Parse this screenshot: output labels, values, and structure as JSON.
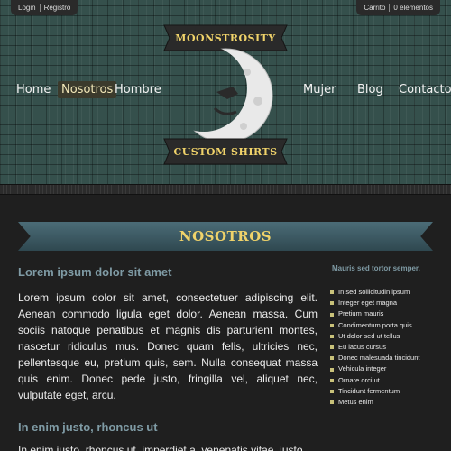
{
  "topbar": {
    "login": "Login",
    "register": "Registro",
    "cart": "Carrito",
    "cart_count": "0 elementos"
  },
  "nav": {
    "home": "Home",
    "about": "Nosotros",
    "men": "Hombre",
    "women": "Mujer",
    "blog": "Blog",
    "contact": "Contacto"
  },
  "logo": {
    "top_text": "MOONSTROSITY",
    "bottom_text": "CUSTOM SHIRTS"
  },
  "page": {
    "banner_title": "NOSOTROS",
    "heading1": "Lorem ipsum dolor sit amet",
    "paragraph1": "Lorem ipsum dolor sit amet, consectetuer adipiscing elit. Aenean commodo ligula eget dolor. Aenean massa. Cum sociis natoque penatibus et magnis dis parturient montes, nascetur ridiculus mus. Donec quam felis, ultricies nec, pellentesque eu, pretium quis, sem. Nulla consequat massa quis enim. Donec pede justo, fringilla vel, aliquet nec, vulputate eget, arcu.",
    "heading2": "In enim justo, rhoncus ut",
    "paragraph2": "In enim justo, rhoncus ut, imperdiet a, venenatis vitae, justo."
  },
  "sidebar": {
    "title": "Mauris sed tortor semper.",
    "items": [
      "In sed sollicitudin ipsum",
      "Integer eget magna",
      "Pretium mauris",
      "Condimentum porta quis",
      "Ut dolor sed ut tellus",
      "Eu lacus cursus",
      "Donec malesuada tincidunt",
      "Vehicula integer",
      "Ornare orci ut",
      "Tincidunt fermentum",
      "Metus enim"
    ]
  },
  "colors": {
    "header_bg": "#35504c",
    "accent_gold": "#f0d36a",
    "heading_blue": "#7f9ba5",
    "page_bg": "#1f1f1f"
  }
}
